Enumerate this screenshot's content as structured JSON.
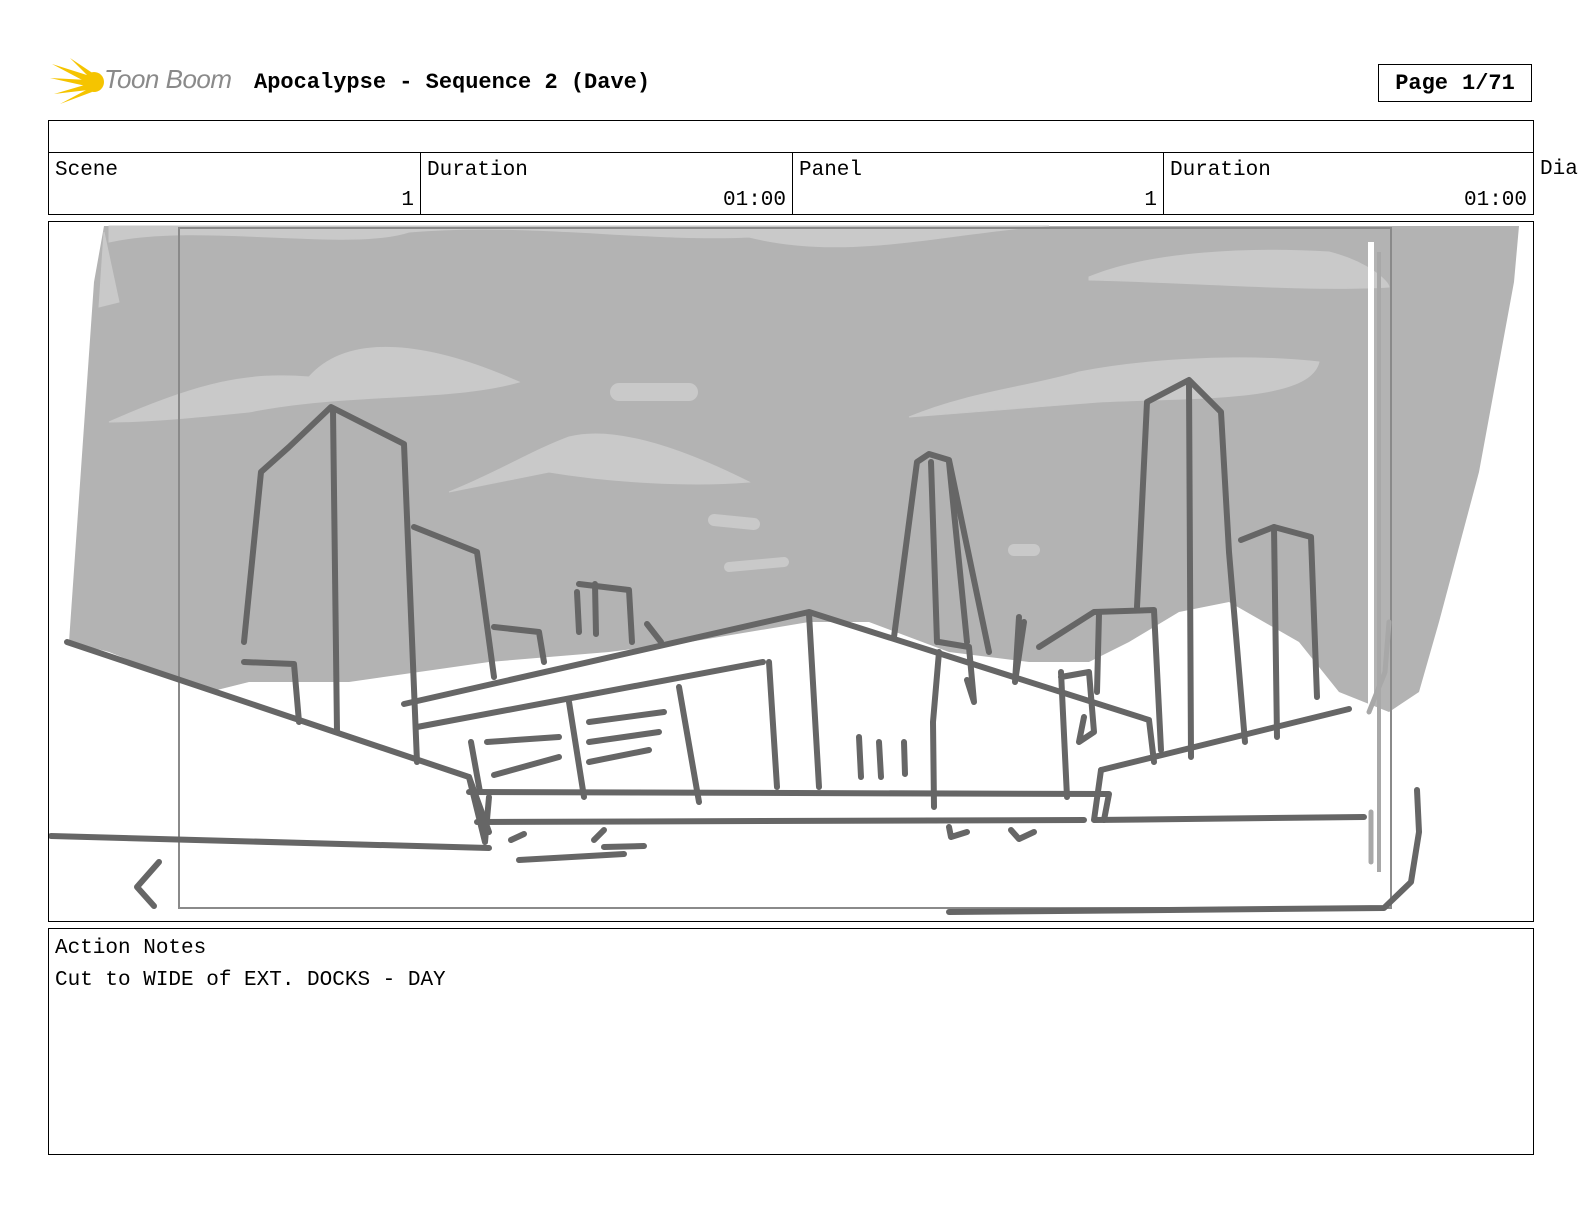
{
  "header": {
    "logo_text": "Toon Boom",
    "title": "Apocalypse - Sequence 2 (Dave)",
    "page_label": "Page",
    "page_value": "1/71"
  },
  "info": {
    "scene_label": "Scene",
    "scene_value": "1",
    "scene_duration_label": "Duration",
    "scene_duration_value": "01:00",
    "panel_label": "Panel",
    "panel_value": "1",
    "panel_duration_label": "Duration",
    "panel_duration_value": "01:00",
    "dialog_label_partial": "Dia"
  },
  "notes": {
    "label": "Action Notes",
    "text": "Cut to WIDE of EXT. DOCKS - DAY"
  },
  "colors": {
    "sky": "#b3b3b3",
    "cloud": "#c9c9c9",
    "line": "#666666",
    "logo_yellow": "#f5c400"
  }
}
